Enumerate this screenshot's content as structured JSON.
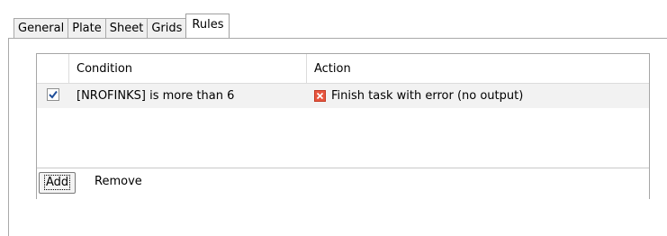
{
  "tabs": [
    {
      "label": "General",
      "active": false
    },
    {
      "label": "Plate",
      "active": false
    },
    {
      "label": "Sheet",
      "active": false
    },
    {
      "label": "Grids",
      "active": false
    },
    {
      "label": "Rules",
      "active": true
    }
  ],
  "rules_grid": {
    "columns": {
      "condition": "Condition",
      "action": "Action"
    },
    "rows": [
      {
        "checked": true,
        "condition": "[NROFINKS] is more than 6",
        "action": "Finish task with error (no output)",
        "action_icon": "error-icon",
        "action_icon_color": "#e8553e"
      }
    ],
    "row_background": "#f2f2f2"
  },
  "buttons": {
    "add": "Add",
    "remove": "Remove"
  }
}
